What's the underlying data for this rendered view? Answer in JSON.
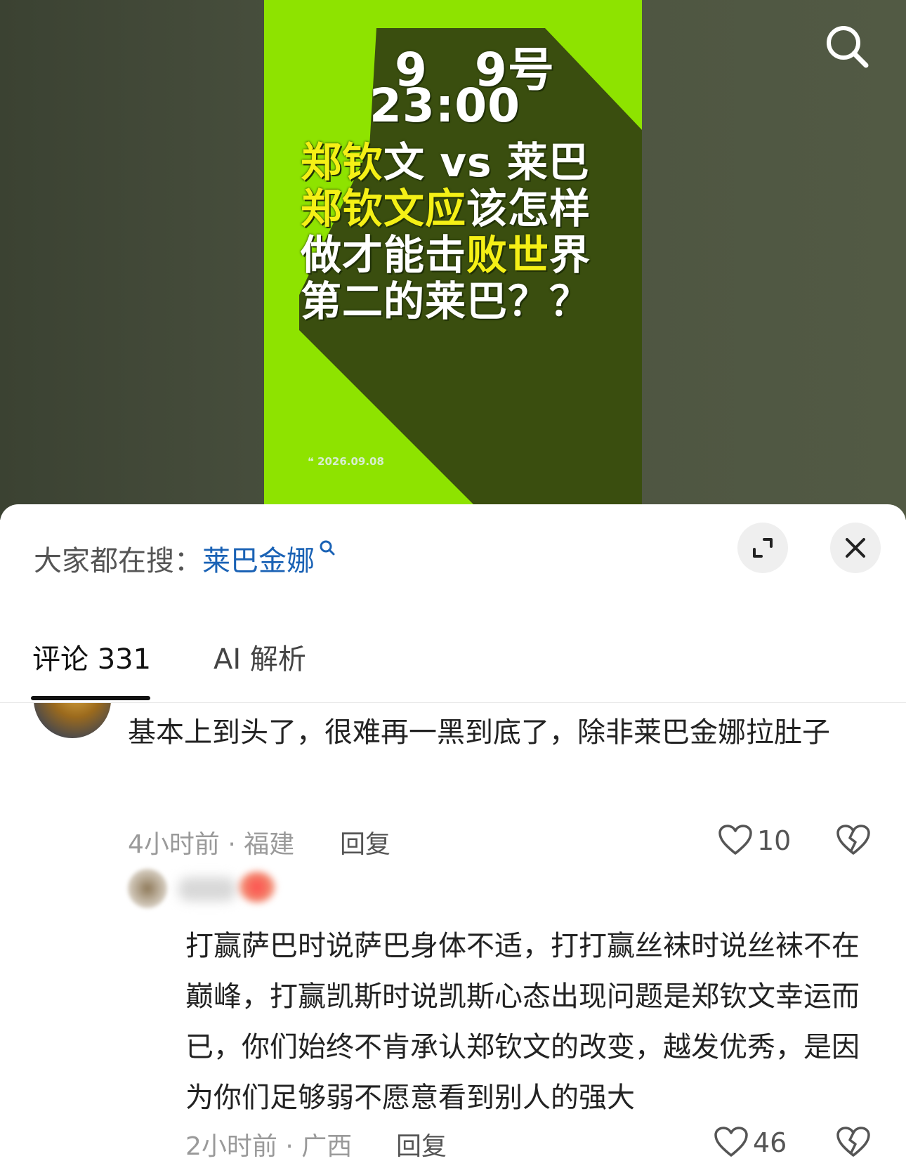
{
  "video": {
    "line1": "9　9号",
    "line2": "23:00",
    "line3_yellow": "郑钦",
    "line3_white": "文 vs 莱巴",
    "line4_yellow": "郑钦文应",
    "line4_white": "该怎样",
    "line5_white_a": "做才能击",
    "line5_yellow": "败世",
    "line5_white_b": "界",
    "line6_white": "第二的莱巴？？",
    "date": "2026.09.08",
    "search_icon": "search-icon"
  },
  "sheet": {
    "hot_search_label": "大家都在搜：",
    "hot_search_keyword": "莱巴金娜",
    "expand_icon": "expand-icon",
    "close_icon": "close-icon"
  },
  "tabs": [
    {
      "label": "评论 331",
      "active": true
    },
    {
      "label": "AI 解析",
      "active": false
    }
  ],
  "comments": [
    {
      "text": "基本上到头了，很难再一黑到底了，除非莱巴金娜拉肚子",
      "meta": "4小时前 · 福建",
      "reply_label": "回复",
      "likes": "10"
    },
    {
      "text": "打赢萨巴时说萨巴身体不适，打打赢丝袜时说丝袜不在巅峰，打赢凯斯时说凯斯心态出现问题是郑钦文幸运而已，你们始终不肯承认郑钦文的改变，越发优秀，是因为你们足够弱不愿意看到别人的强大",
      "meta": "2小时前 · 广西",
      "reply_label": "回复",
      "likes": "46"
    }
  ],
  "colors": {
    "video_green": "#8ee300",
    "video_shadow": "#3a4e0f",
    "highlight_yellow": "#f5f016",
    "link_blue": "#1a62b5"
  }
}
